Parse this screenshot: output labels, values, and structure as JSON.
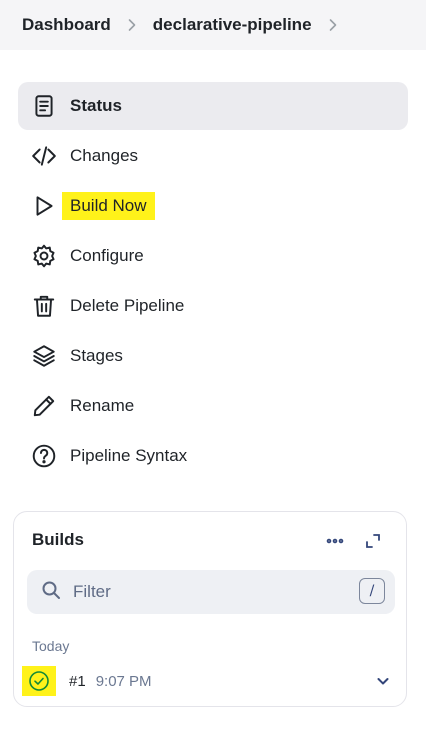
{
  "breadcrumb": {
    "items": [
      {
        "label": "Dashboard"
      },
      {
        "label": "declarative-pipeline"
      }
    ]
  },
  "nav": {
    "items": [
      {
        "label": "Status",
        "icon": "document-icon",
        "active": true
      },
      {
        "label": "Changes",
        "icon": "code-icon"
      },
      {
        "label": "Build Now",
        "icon": "play-icon",
        "highlighted": true
      },
      {
        "label": "Configure",
        "icon": "gear-icon"
      },
      {
        "label": "Delete Pipeline",
        "icon": "trash-icon"
      },
      {
        "label": "Stages",
        "icon": "layers-icon"
      },
      {
        "label": "Rename",
        "icon": "pencil-icon"
      },
      {
        "label": "Pipeline Syntax",
        "icon": "help-circle-icon"
      }
    ]
  },
  "builds": {
    "title": "Builds",
    "filter_placeholder": "Filter",
    "filter_shortcut": "/",
    "group_label": "Today",
    "rows": [
      {
        "number": "#1",
        "time": "9:07 PM",
        "status": "success"
      }
    ]
  },
  "colors": {
    "highlight": "#fff21a",
    "success": "#138a36",
    "active_bg": "#ebebef",
    "breadcrumb_bg": "#f5f5f7"
  }
}
